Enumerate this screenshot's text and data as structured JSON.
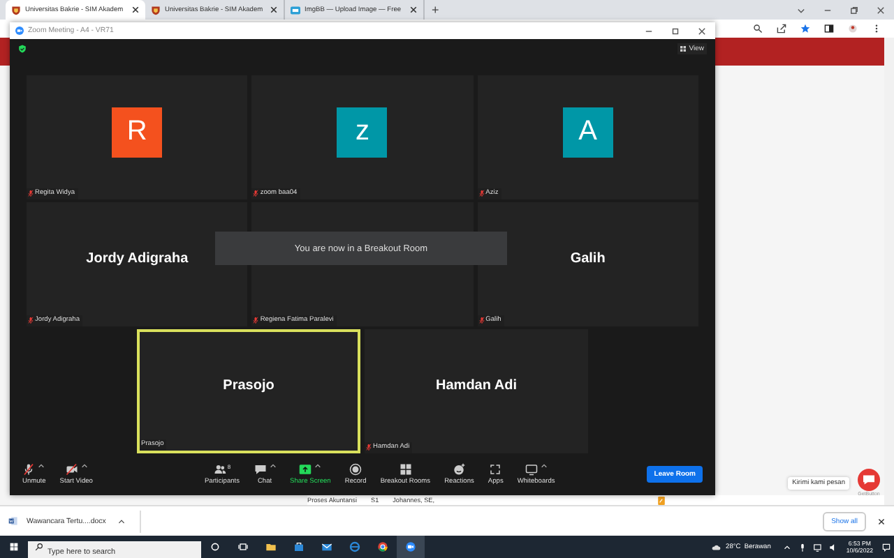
{
  "browser": {
    "tabs": [
      {
        "title": "Universitas Bakrie - SIM Akadem",
        "selected": true
      },
      {
        "title": "Universitas Bakrie - SIM Akadem",
        "selected": false
      },
      {
        "title": "ImgBB — Upload Image — Free",
        "selected": false
      }
    ],
    "new_tab": "+"
  },
  "page": {
    "table_cells": [
      "Proses Akuntansi",
      "S1",
      "Johannes, SE,"
    ]
  },
  "zoom": {
    "title": "Zoom Meeting - A4 - VR71",
    "view_label": "View",
    "tile_rows": [
      [
        {
          "kind": "avatar",
          "initial": "R",
          "color": "#f4511e",
          "label": "Regita Widya",
          "muted": true,
          "speaking": false
        },
        {
          "kind": "avatar",
          "initial": "z",
          "color": "#0097a7",
          "label": "zoom baa04",
          "muted": true,
          "speaking": false
        },
        {
          "kind": "avatar",
          "initial": "A",
          "color": "#0097a7",
          "label": "Aziz",
          "muted": true,
          "speaking": false
        }
      ],
      [
        {
          "kind": "name",
          "name": "Jordy Adigraha",
          "label": "Jordy Adigraha",
          "muted": true,
          "speaking": false
        },
        {
          "kind": "blank",
          "label": "Regiena Fatima Paralevi",
          "muted": true,
          "speaking": false
        },
        {
          "kind": "name",
          "name": "Galih",
          "label": "Galih",
          "muted": true,
          "speaking": false
        }
      ],
      [
        {
          "kind": "name",
          "name": "Prasojo",
          "label": "Prasojo",
          "muted": false,
          "speaking": true
        },
        {
          "kind": "name",
          "name": "Hamdan Adi",
          "label": "Hamdan Adi",
          "muted": true,
          "speaking": false
        }
      ]
    ],
    "notice": "You are now in a Breakout Room",
    "toolbar_left": [
      {
        "label": "Unmute",
        "caret": true
      },
      {
        "label": "Start Video",
        "caret": true
      }
    ],
    "toolbar_center": [
      {
        "label": "Participants",
        "caret": false,
        "badge": "8",
        "highlight": false
      },
      {
        "label": "Chat",
        "caret": true,
        "highlight": false
      },
      {
        "label": "Share Screen",
        "caret": true,
        "highlight": true
      },
      {
        "label": "Record",
        "caret": false,
        "highlight": false
      },
      {
        "label": "Breakout Rooms",
        "caret": false,
        "highlight": false
      },
      {
        "label": "Reactions",
        "caret": false,
        "highlight": false
      },
      {
        "label": "Apps",
        "caret": false,
        "highlight": false
      },
      {
        "label": "Whiteboards",
        "caret": true,
        "highlight": false
      }
    ],
    "leave_label": "Leave Room"
  },
  "chat_widget": {
    "label": "Kirimi kami pesan",
    "brand": "GetButton"
  },
  "downloads": {
    "file": "Wawancara Tertu....docx",
    "show_all": "Show all"
  },
  "taskbar": {
    "search_placeholder": "Type here to search",
    "weather": "28°C  Berawan",
    "time": "6:53 PM",
    "date": "10/6/2022"
  }
}
